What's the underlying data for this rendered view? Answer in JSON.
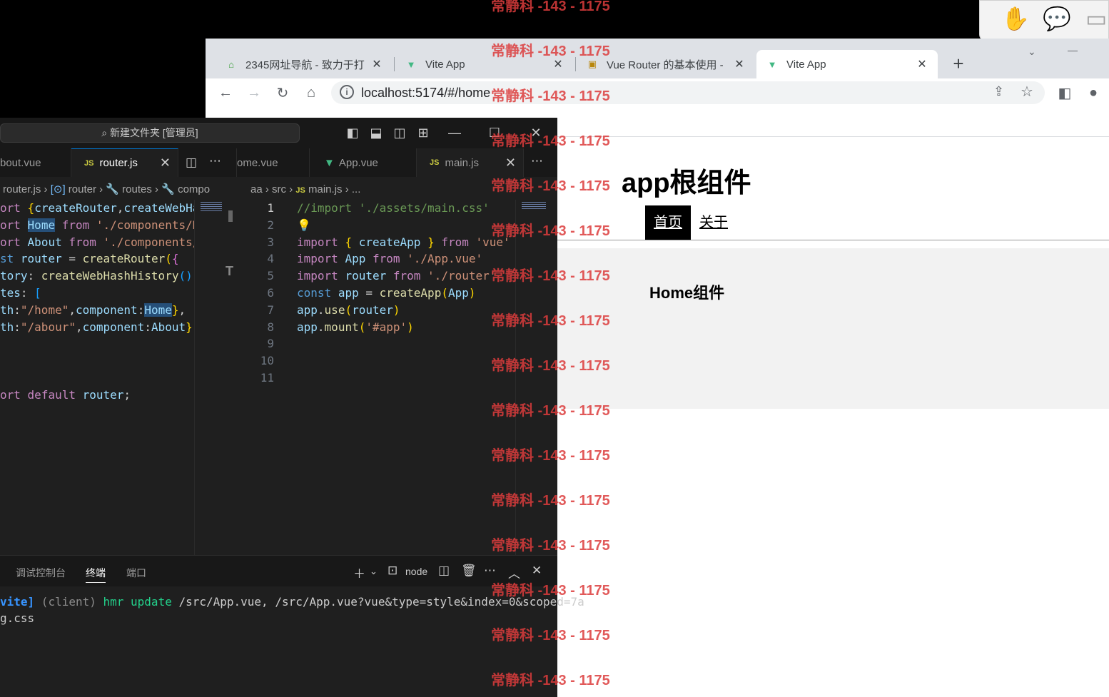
{
  "browser": {
    "tabs": [
      {
        "title": "2345网址导航 - 致力于打",
        "icon": "2345-favicon",
        "close": "✕"
      },
      {
        "title": "Vite App",
        "icon": "vue-logo-icon",
        "close": "✕"
      },
      {
        "title": "Vue Router 的基本使用 -",
        "icon": "article-favicon",
        "close": "✕"
      },
      {
        "title": "Vite App",
        "icon": "vue-logo-icon",
        "close": "✕"
      }
    ],
    "new_tab": "+",
    "url": "localhost:5174/#/home",
    "page": {
      "heading": "app根组件",
      "nav": [
        "首页",
        "关于"
      ],
      "view_title": "Home组件"
    }
  },
  "vscode": {
    "command_center": "新建文件夹 [管理员]",
    "tabs_left": [
      {
        "label": "bout.vue"
      },
      {
        "label": "router.js",
        "badge": "JS"
      }
    ],
    "tabs_right": [
      {
        "label": "ome.vue"
      },
      {
        "label": "App.vue"
      },
      {
        "label": "main.js",
        "badge": "JS"
      }
    ],
    "breadcrumb_left": [
      "router.js",
      "router",
      "routes",
      "compo"
    ],
    "breadcrumb_right": [
      "aa",
      "src",
      "main.js",
      "..."
    ],
    "line_numbers": [
      "1",
      "2",
      "3",
      "4",
      "5",
      "6",
      "7",
      "8",
      "9",
      "10",
      "11"
    ],
    "panel": {
      "tabs": [
        "调试控制台",
        "终端",
        "端口"
      ],
      "shell": "node",
      "terminal_lines": [
        "vite] (client) hmr update /src/App.vue, /src/App.vue?vue&type=style&index=0&scoped=7a",
        "g.css"
      ]
    }
  },
  "watermark": "常静科 -143 - 1175",
  "colors": {
    "vscode_bg": "#1f1f1f",
    "accent": "#0078d4",
    "watermark": "#dc3c3c"
  }
}
